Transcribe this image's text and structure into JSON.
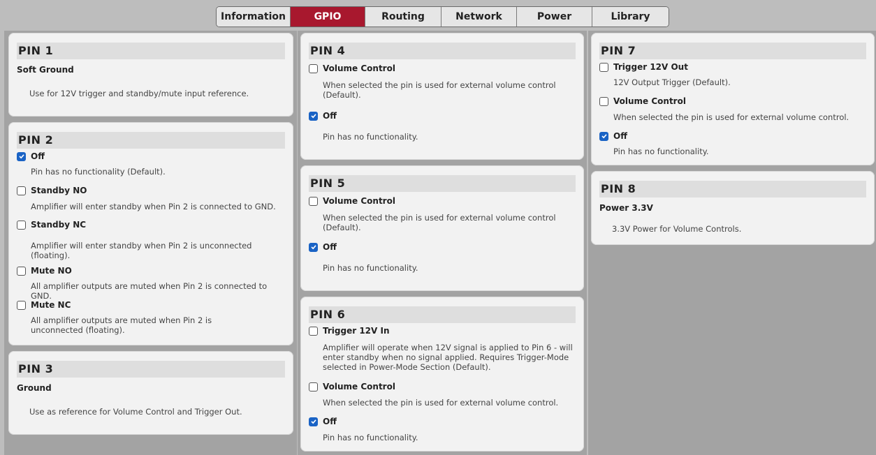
{
  "tabs": [
    "Information",
    "GPIO",
    "Routing",
    "Network",
    "Power",
    "Library"
  ],
  "active_tab": "GPIO",
  "colors": {
    "active_tab": "#a8182e",
    "checkbox_on": "#1a63c5"
  },
  "pins": {
    "p1": {
      "title": "PIN 1",
      "subtitle": "Soft Ground",
      "desc": "Use for 12V trigger and standby/mute input reference."
    },
    "p2": {
      "title": "PIN 2",
      "options": [
        {
          "label": "Off",
          "checked": true,
          "desc": "Pin has no functionality (Default)."
        },
        {
          "label": "Standby NO",
          "checked": false,
          "desc": "Amplifier will enter standby when Pin 2 is connected to GND."
        },
        {
          "label": "Standby NC",
          "checked": false,
          "desc": "Amplifier will enter standby when Pin 2 is unconnected (floating)."
        },
        {
          "label": "Mute NO",
          "checked": false,
          "desc": "All amplifier outputs are muted when Pin 2 is connected to GND."
        },
        {
          "label": "Mute NC",
          "checked": false,
          "desc": "All amplifier outputs are muted when Pin 2 is unconnected (floating)."
        }
      ]
    },
    "p3": {
      "title": "PIN 3",
      "subtitle": "Ground",
      "desc": "Use as reference for Volume Control and Trigger Out."
    },
    "p4": {
      "title": "PIN 4",
      "options": [
        {
          "label": "Volume Control",
          "checked": false,
          "desc": "When selected the pin is used for external volume control (Default)."
        },
        {
          "label": "Off",
          "checked": true,
          "desc": "Pin has no functionality."
        }
      ]
    },
    "p5": {
      "title": "PIN 5",
      "options": [
        {
          "label": "Volume Control",
          "checked": false,
          "desc": "When selected the pin is used for external volume control (Default)."
        },
        {
          "label": "Off",
          "checked": true,
          "desc": "Pin has no functionality."
        }
      ]
    },
    "p6": {
      "title": "PIN 6",
      "options": [
        {
          "label": "Trigger 12V In",
          "checked": false,
          "desc": "Amplifier will operate when 12V signal is applied to Pin 6 - will enter standby when no signal applied. Requires Trigger-Mode selected in Power-Mode Section (Default)."
        },
        {
          "label": "Volume Control",
          "checked": false,
          "desc": "When selected the pin is used for external volume control."
        },
        {
          "label": "Off",
          "checked": true,
          "desc": "Pin has no functionality."
        }
      ]
    },
    "p7": {
      "title": "PIN 7",
      "options": [
        {
          "label": "Trigger 12V Out",
          "checked": false,
          "desc": "12V Output Trigger (Default)."
        },
        {
          "label": "Volume Control",
          "checked": false,
          "desc": "When selected the pin is used for external volume control."
        },
        {
          "label": "Off",
          "checked": true,
          "desc": "Pin has no functionality."
        }
      ]
    },
    "p8": {
      "title": "PIN 8",
      "subtitle": "Power 3.3V",
      "desc": "3.3V Power for Volume Controls."
    }
  }
}
